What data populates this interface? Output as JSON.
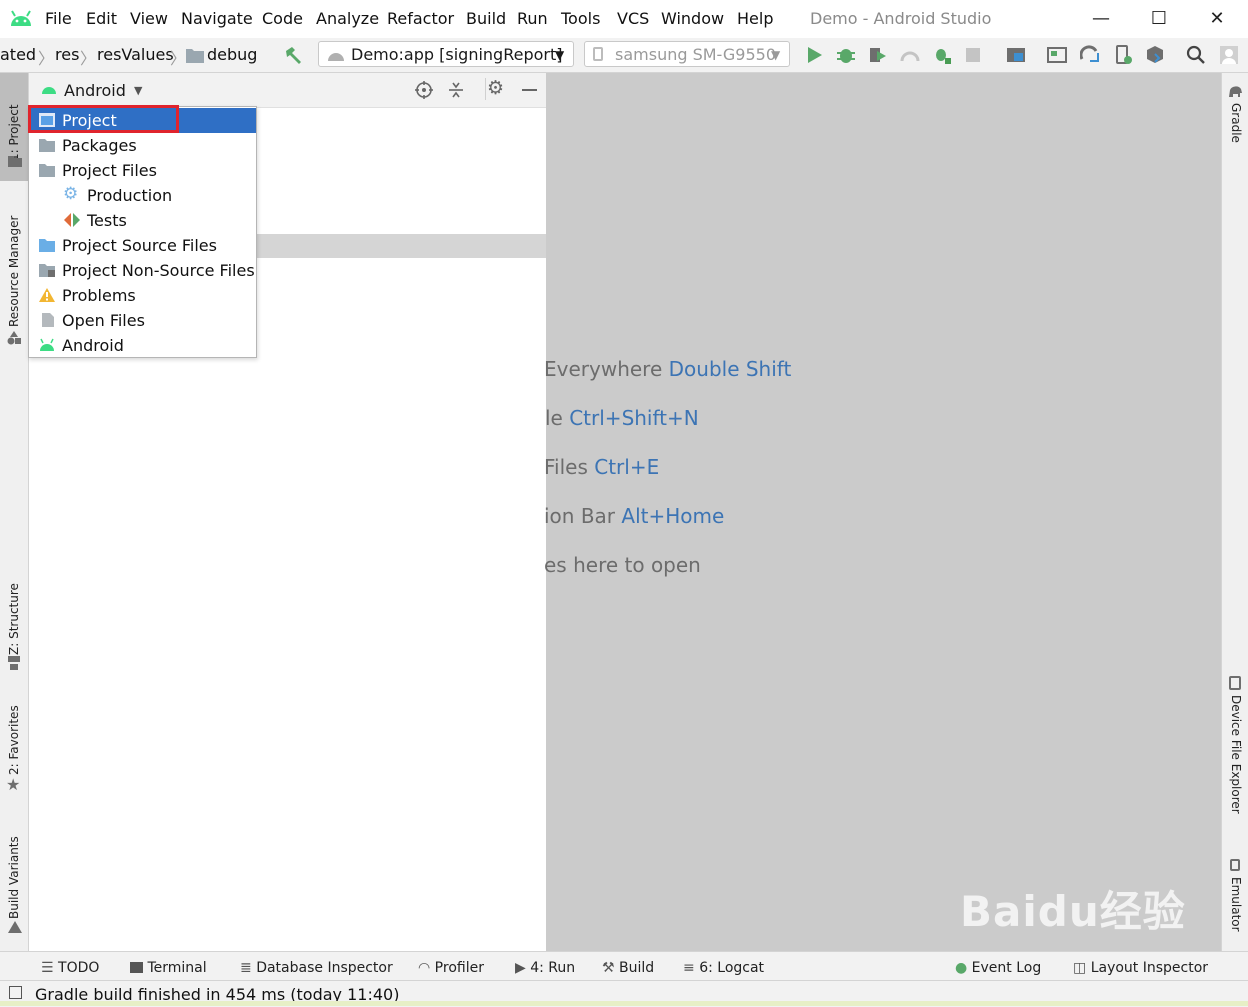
{
  "menu": [
    "File",
    "Edit",
    "View",
    "Navigate",
    "Code",
    "Analyze",
    "Refactor",
    "Build",
    "Run",
    "Tools",
    "VCS",
    "Window",
    "Help"
  ],
  "window_title": "Demo - Android Studio",
  "window_controls": {
    "minimize": "—",
    "maximize": "☐",
    "close": "✕"
  },
  "breadcrumb": {
    "item1": "ated",
    "item2": "res",
    "item3": "resValues",
    "item4": "debug"
  },
  "run_config": "Demo:app [signingReport]",
  "device": "samsung SM-G9550",
  "panel": {
    "view_selector": "Android"
  },
  "popup_items": [
    "Project",
    "Packages",
    "Project Files",
    "Production",
    "Tests",
    "Project Source Files",
    "Project Non-Source Files",
    "Problems",
    "Open Files",
    "Android"
  ],
  "editor_hints": [
    {
      "text": "Everywhere ",
      "key": "Double Shift"
    },
    {
      "text": "le ",
      "key": "Ctrl+Shift+N"
    },
    {
      "text": "Files ",
      "key": "Ctrl+E"
    },
    {
      "text": "ion Bar ",
      "key": "Alt+Home"
    },
    {
      "text": "es here to open",
      "key": ""
    }
  ],
  "left_tabs": [
    "1: Project",
    "Resource Manager",
    "Z: Structure",
    "2: Favorites",
    "Build Variants"
  ],
  "right_tabs": [
    "Gradle",
    "Device File Explorer",
    "Emulator"
  ],
  "bottom_tools": [
    "TODO",
    "Terminal",
    "Database Inspector",
    "Profiler",
    "4: Run",
    "Build",
    "6: Logcat",
    "Event Log",
    "Layout Inspector"
  ],
  "status": "Gradle build finished in 454 ms (today 11:40)",
  "watermark": "Baidu经验",
  "colors": {
    "accent": "#2f6fc5",
    "android_green": "#3ddc84",
    "highlight": "#e0242d",
    "hint_key": "#3c74b4"
  }
}
